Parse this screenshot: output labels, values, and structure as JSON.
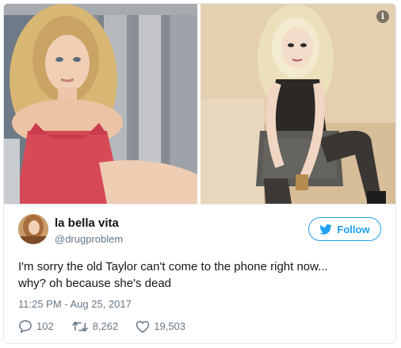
{
  "media": {
    "info_icon": "i"
  },
  "author": {
    "display_name": "la bella vita",
    "handle": "@drugproblem"
  },
  "follow_button": {
    "label": "Follow",
    "icon": "twitter-bird-icon"
  },
  "tweet": {
    "text_line1": "I'm sorry the old Taylor can't come to the phone right now...",
    "text_line2": "why? oh because she's dead",
    "timestamp": "11:25 PM - Aug 25, 2017"
  },
  "actions": {
    "replies": "102",
    "retweets": "8,262",
    "likes": "19,503"
  },
  "colors": {
    "accent": "#1da1f2",
    "text": "#14171a",
    "muted": "#657786",
    "border": "#e1e8ed"
  }
}
